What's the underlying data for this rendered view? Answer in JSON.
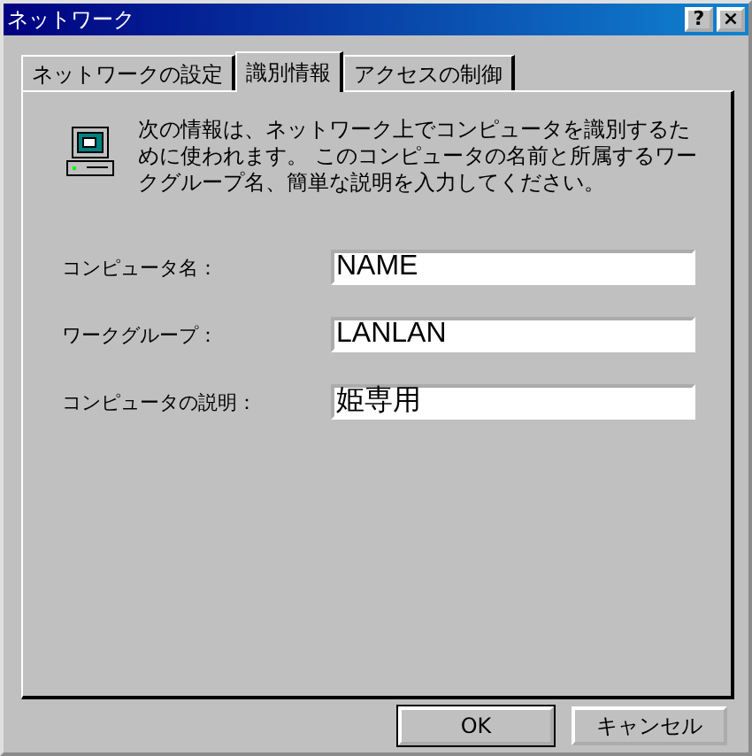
{
  "window": {
    "title": "ネットワーク",
    "buttons": [
      "?",
      "×"
    ]
  },
  "tabs": [
    {
      "label": "ネットワークの設定",
      "selected": false
    },
    {
      "label": "識別情報",
      "selected": true
    },
    {
      "label": "アクセスの制御",
      "selected": false
    }
  ],
  "description": "次の情報は、ネットワーク上でコンピュータを識別するために使われます。 このコンピュータの名前と所属するワークグループ名、簡単な説明を入力してください。",
  "fields": [
    {
      "label": "コンピュータ名：",
      "value": "NAME"
    },
    {
      "label": "ワークグループ：",
      "value": "LANLAN"
    },
    {
      "label": "コンピュータの説明：",
      "value": "姫専用"
    }
  ],
  "buttons": [
    "OK",
    "キャンセル"
  ]
}
